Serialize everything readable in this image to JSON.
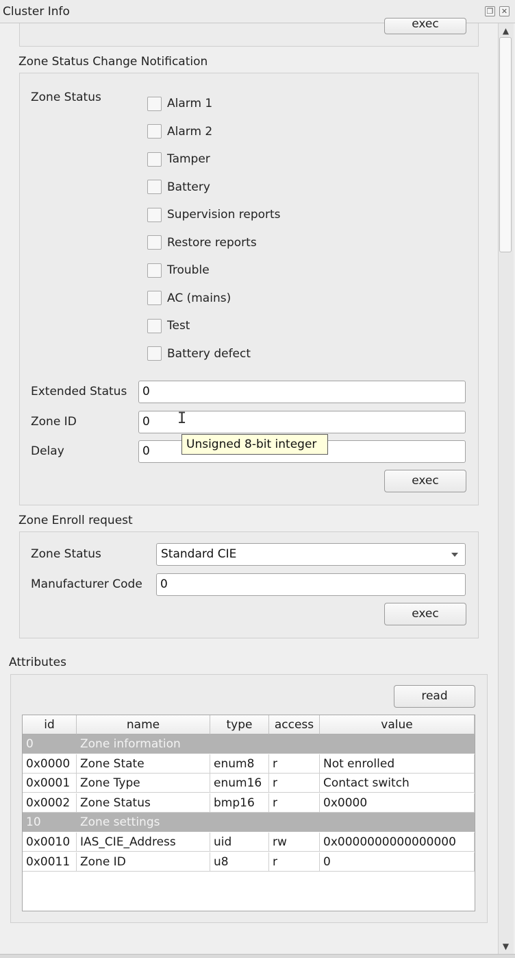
{
  "window": {
    "title": "Cluster Info"
  },
  "top_section": {
    "exec_label": "exec"
  },
  "zone_status_change": {
    "title": "Zone Status Change Notification",
    "zone_status_label": "Zone Status",
    "checkboxes": [
      {
        "label": "Alarm 1",
        "checked": false
      },
      {
        "label": "Alarm 2",
        "checked": false
      },
      {
        "label": "Tamper",
        "checked": false
      },
      {
        "label": "Battery",
        "checked": false
      },
      {
        "label": "Supervision reports",
        "checked": false
      },
      {
        "label": "Restore reports",
        "checked": false
      },
      {
        "label": "Trouble",
        "checked": false
      },
      {
        "label": "AC (mains)",
        "checked": false
      },
      {
        "label": "Test",
        "checked": false
      },
      {
        "label": "Battery defect",
        "checked": false
      }
    ],
    "extended_status": {
      "label": "Extended Status",
      "value": "0"
    },
    "zone_id": {
      "label": "Zone ID",
      "value": "0"
    },
    "delay": {
      "label": "Delay",
      "value": "0"
    },
    "tooltip": "Unsigned 8-bit integer",
    "exec_label": "exec"
  },
  "zone_enroll": {
    "title": "Zone Enroll request",
    "zone_status_label": "Zone Status",
    "zone_status_value": "Standard CIE",
    "manufacturer_code": {
      "label": "Manufacturer Code",
      "value": "0"
    },
    "exec_label": "exec"
  },
  "attributes": {
    "title": "Attributes",
    "read_label": "read",
    "columns": [
      "id",
      "name",
      "type",
      "access",
      "value"
    ],
    "rows": [
      {
        "group": true,
        "id": "0",
        "name": "Zone information"
      },
      {
        "group": false,
        "id": "0x0000",
        "name": "Zone State",
        "type": "enum8",
        "access": "r",
        "value": "Not enrolled"
      },
      {
        "group": false,
        "id": "0x0001",
        "name": "Zone Type",
        "type": "enum16",
        "access": "r",
        "value": "Contact switch"
      },
      {
        "group": false,
        "id": "0x0002",
        "name": "Zone Status",
        "type": "bmp16",
        "access": "r",
        "value": "0x0000"
      },
      {
        "group": true,
        "id": "10",
        "name": "Zone settings"
      },
      {
        "group": false,
        "id": "0x0010",
        "name": "IAS_CIE_Address",
        "type": "uid",
        "access": "rw",
        "value": "0x0000000000000000"
      },
      {
        "group": false,
        "id": "0x0011",
        "name": "Zone ID",
        "type": "u8",
        "access": "r",
        "value": "0"
      }
    ]
  }
}
